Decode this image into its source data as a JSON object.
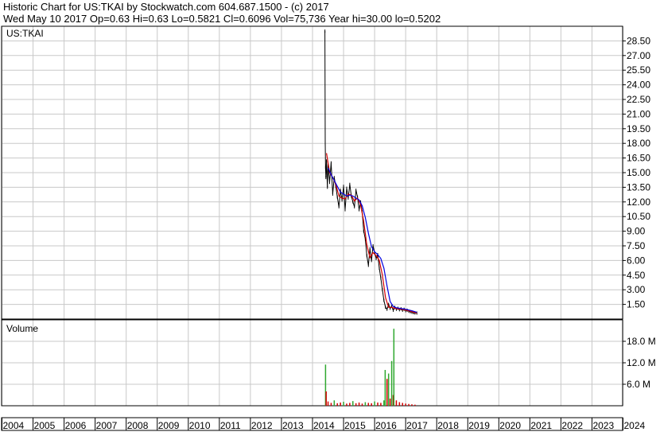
{
  "header": {
    "line1": "Historic Chart for US:TKAI by Stockwatch.com 604.687.1500 - (c) 2017",
    "line2": "Wed May 10 2017   Op=0.63  Hi=0.63  Lo=0.5821  Cl=0.6096  Vol=75,736  Year hi=30.00  lo=0.5202"
  },
  "colors": {
    "price": "#000000",
    "ma_short": "#d40000",
    "ma_long": "#0000e0",
    "volume_up": "#2fa82f",
    "volume_down": "#d40000",
    "grid": "#c8c8c8",
    "frame": "#000000"
  },
  "chart_data": [
    {
      "type": "line",
      "panel": "price",
      "title": "US:TKAI",
      "ylim": [
        0,
        30
      ],
      "y_ticks": [
        "1.50",
        "3.00",
        "4.50",
        "6.00",
        "7.50",
        "9.00",
        "10.50",
        "12.00",
        "13.50",
        "15.00",
        "16.50",
        "18.00",
        "19.50",
        "21.00",
        "22.50",
        "24.00",
        "25.50",
        "27.00",
        "28.50"
      ],
      "x_years": [
        "2004",
        "2005",
        "2006",
        "2007",
        "2008",
        "2009",
        "2010",
        "2011",
        "2012",
        "2013",
        "2014",
        "2015",
        "2016",
        "2017",
        "2018",
        "2019",
        "2020",
        "2021",
        "2022",
        "2023",
        "2024"
      ],
      "series": [
        {
          "role": "price",
          "x": [
            2014.4,
            2014.41,
            2014.42,
            2014.43,
            2014.45,
            2014.48,
            2014.5,
            2014.55,
            2014.6,
            2014.65,
            2014.7,
            2014.75,
            2014.8,
            2014.85,
            2014.9,
            2014.95,
            2015.0,
            2015.05,
            2015.1,
            2015.15,
            2015.2,
            2015.25,
            2015.3,
            2015.35,
            2015.4,
            2015.45,
            2015.5,
            2015.55,
            2015.6,
            2015.65,
            2015.7,
            2015.75,
            2015.8,
            2015.85,
            2015.9,
            2015.95,
            2016.0,
            2016.05,
            2016.1,
            2016.15,
            2016.2,
            2016.25,
            2016.3,
            2016.35,
            2016.4,
            2016.45,
            2016.5,
            2016.55,
            2016.6,
            2016.65,
            2016.7,
            2016.75,
            2016.8,
            2016.85,
            2016.9,
            2016.95,
            2017.0,
            2017.05,
            2017.1,
            2017.15,
            2017.2,
            2017.25,
            2017.3,
            2017.36
          ],
          "values": [
            29.5,
            18.0,
            15.5,
            14.5,
            16.2,
            13.5,
            15.8,
            14.0,
            16.0,
            12.8,
            14.5,
            13.6,
            12.5,
            11.5,
            13.2,
            12.2,
            13.6,
            11.2,
            13.4,
            12.4,
            13.8,
            12.6,
            12.0,
            11.5,
            13.2,
            12.5,
            11.2,
            12.0,
            11.0,
            9.0,
            8.2,
            6.5,
            5.5,
            7.2,
            6.0,
            7.5,
            6.8,
            6.2,
            6.6,
            5.2,
            4.2,
            3.0,
            1.9,
            1.2,
            1.0,
            1.5,
            1.1,
            1.3,
            0.9,
            1.2,
            1.0,
            1.1,
            0.95,
            1.05,
            0.9,
            1.0,
            0.85,
            0.9,
            0.8,
            0.75,
            0.7,
            0.65,
            0.62,
            0.61
          ]
        },
        {
          "role": "moving_average_short",
          "x": [
            2014.45,
            2014.55,
            2014.65,
            2014.75,
            2014.85,
            2014.95,
            2015.05,
            2015.15,
            2015.25,
            2015.35,
            2015.45,
            2015.55,
            2015.65,
            2015.75,
            2015.85,
            2015.95,
            2016.05,
            2016.15,
            2016.25,
            2016.35,
            2016.45,
            2016.55,
            2016.65,
            2016.75,
            2016.85,
            2016.95,
            2017.05,
            2017.15,
            2017.25,
            2017.36
          ],
          "values": [
            17.0,
            15.0,
            14.5,
            13.8,
            12.6,
            12.4,
            12.3,
            12.8,
            12.7,
            12.1,
            12.4,
            11.7,
            10.0,
            7.6,
            6.3,
            6.8,
            6.5,
            6.0,
            4.5,
            2.2,
            1.2,
            1.2,
            1.1,
            1.05,
            1.0,
            0.95,
            0.88,
            0.8,
            0.7,
            0.62
          ]
        },
        {
          "role": "moving_average_long",
          "x": [
            2014.5,
            2014.6,
            2014.7,
            2014.8,
            2014.9,
            2015.0,
            2015.1,
            2015.2,
            2015.3,
            2015.4,
            2015.5,
            2015.6,
            2015.7,
            2015.8,
            2015.9,
            2016.0,
            2016.1,
            2016.2,
            2016.3,
            2016.4,
            2016.5,
            2016.6,
            2016.7,
            2016.8,
            2016.9,
            2017.0,
            2017.1,
            2017.2,
            2017.3,
            2017.36
          ],
          "values": [
            15.5,
            14.8,
            14.2,
            13.6,
            13.0,
            12.8,
            12.6,
            12.7,
            12.6,
            12.4,
            12.2,
            11.6,
            10.4,
            8.8,
            7.4,
            6.9,
            6.6,
            6.2,
            5.2,
            3.4,
            1.8,
            1.3,
            1.15,
            1.1,
            1.05,
            1.0,
            0.92,
            0.85,
            0.75,
            0.68
          ]
        }
      ]
    },
    {
      "type": "bar",
      "panel": "volume",
      "title": "Volume",
      "ylim": [
        0,
        24
      ],
      "unit": "M",
      "y_ticks": [
        "6.0 M",
        "12.0 M",
        "18.0 M"
      ],
      "x": [
        2014.42,
        2014.44,
        2014.5,
        2014.6,
        2014.7,
        2014.8,
        2014.9,
        2015.0,
        2015.1,
        2015.2,
        2015.3,
        2015.4,
        2015.5,
        2015.6,
        2015.7,
        2015.8,
        2015.9,
        2016.0,
        2016.1,
        2016.2,
        2016.3,
        2016.34,
        2016.4,
        2016.45,
        2016.5,
        2016.55,
        2016.6,
        2016.62,
        2016.7,
        2016.8,
        2016.9,
        2017.0,
        2017.1,
        2017.2,
        2017.3
      ],
      "values": [
        11.5,
        4.0,
        1.2,
        0.8,
        1.5,
        0.7,
        0.9,
        1.1,
        0.6,
        0.8,
        1.3,
        0.7,
        0.9,
        0.6,
        1.0,
        0.8,
        0.7,
        1.2,
        0.9,
        0.8,
        1.5,
        10.0,
        7.5,
        9.0,
        2.0,
        12.5,
        3.0,
        21.5,
        1.5,
        1.0,
        0.8,
        0.6,
        0.5,
        0.4,
        0.3
      ],
      "direction": [
        "up",
        "down",
        "down",
        "down",
        "up",
        "down",
        "down",
        "up",
        "down",
        "down",
        "up",
        "down",
        "down",
        "down",
        "up",
        "down",
        "down",
        "up",
        "down",
        "down",
        "up",
        "up",
        "down",
        "up",
        "down",
        "up",
        "down",
        "up",
        "down",
        "down",
        "down",
        "down",
        "down",
        "down",
        "down"
      ]
    }
  ]
}
